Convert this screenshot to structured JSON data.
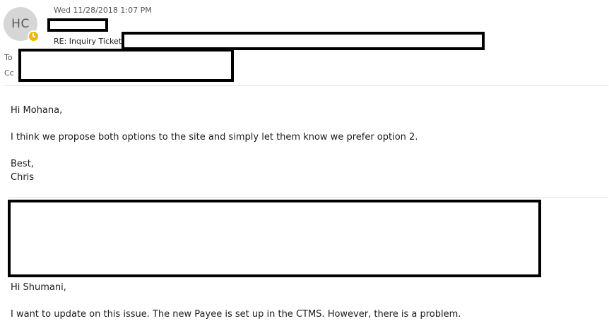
{
  "message": {
    "sender_initials": "HC",
    "date": "Wed 11/28/2018 1:07 PM",
    "subject_prefix": "RE: Inquiry Ticket -",
    "to_label": "To",
    "cc_label": "Cc"
  },
  "reply": {
    "greeting": "Hi Mohana,",
    "paragraph": "I think we propose both options to the site and simply let them know we prefer option 2.",
    "closing": "Best,",
    "signature": "Chris"
  },
  "quoted": {
    "greeting": "Hi Shumani,",
    "paragraph": "I want to update on this issue. The new Payee is set up in the CTMS. However, there is a problem."
  },
  "colors": {
    "avatar_bg": "#d6d6d6",
    "presence_away": "#f4b400",
    "redaction": "#000000"
  }
}
